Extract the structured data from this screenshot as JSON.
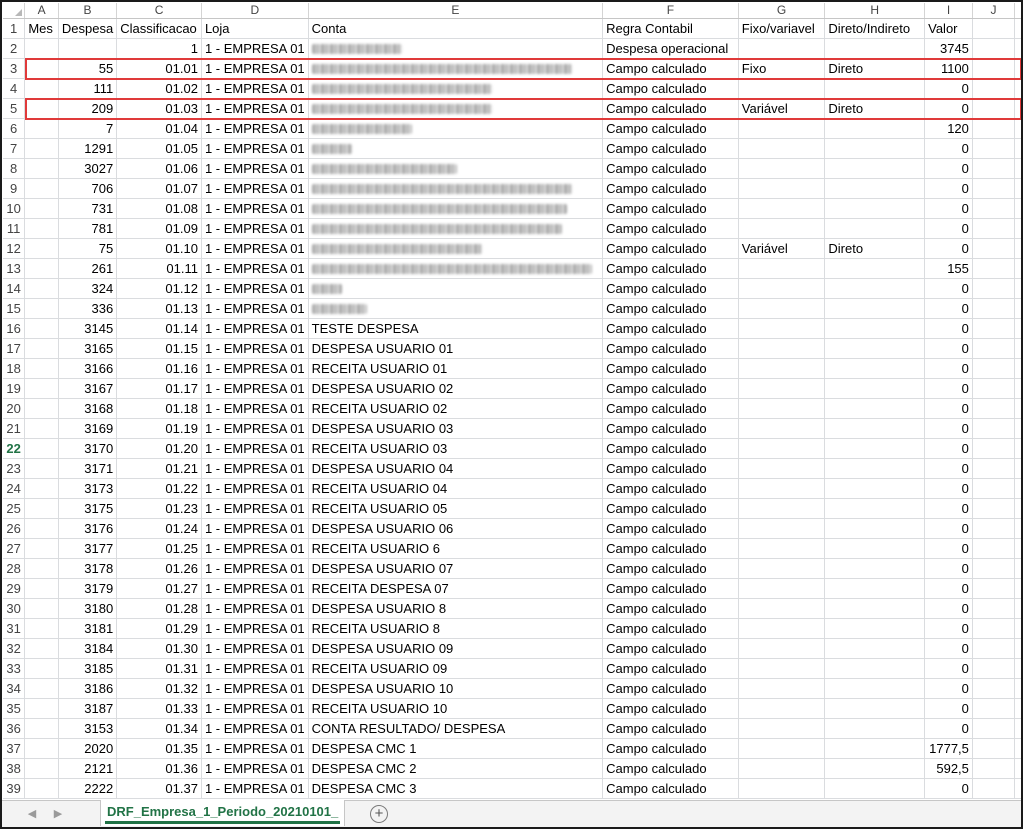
{
  "columns": [
    "A",
    "B",
    "C",
    "D",
    "E",
    "F",
    "G",
    "H",
    "I",
    "J"
  ],
  "rows": [
    {
      "n": "1",
      "cells": [
        "Mes",
        "Despesa",
        "Classificacao",
        "Loja",
        "Conta",
        "Regra Contabil",
        "Fixo/variavel",
        "Direto/Indireto",
        "Valor",
        ""
      ]
    },
    {
      "n": "2",
      "cells": [
        "",
        "",
        "1",
        "1 - EMPRESA 01",
        "",
        "Despesa operacional",
        "",
        "",
        "3745",
        ""
      ]
    },
    {
      "n": "3",
      "cells": [
        "",
        "55",
        "01.01",
        "1 - EMPRESA 01",
        "",
        "Campo calculado",
        "Fixo",
        "Direto",
        "1100",
        ""
      ]
    },
    {
      "n": "4",
      "cells": [
        "",
        "111",
        "01.02",
        "1 - EMPRESA 01",
        "",
        "Campo calculado",
        "",
        "",
        "0",
        ""
      ]
    },
    {
      "n": "5",
      "cells": [
        "",
        "209",
        "01.03",
        "1 - EMPRESA 01",
        "",
        "Campo calculado",
        "Variável",
        "Direto",
        "0",
        ""
      ]
    },
    {
      "n": "6",
      "cells": [
        "",
        "7",
        "01.04",
        "1 - EMPRESA 01",
        "",
        "Campo calculado",
        "",
        "",
        "120",
        ""
      ]
    },
    {
      "n": "7",
      "cells": [
        "",
        "1291",
        "01.05",
        "1 - EMPRESA 01",
        "",
        "Campo calculado",
        "",
        "",
        "0",
        ""
      ]
    },
    {
      "n": "8",
      "cells": [
        "",
        "3027",
        "01.06",
        "1 - EMPRESA 01",
        "",
        "Campo calculado",
        "",
        "",
        "0",
        ""
      ]
    },
    {
      "n": "9",
      "cells": [
        "",
        "706",
        "01.07",
        "1 - EMPRESA 01",
        "",
        "Campo calculado",
        "",
        "",
        "0",
        ""
      ]
    },
    {
      "n": "10",
      "cells": [
        "",
        "731",
        "01.08",
        "1 - EMPRESA 01",
        "",
        "Campo calculado",
        "",
        "",
        "0",
        ""
      ]
    },
    {
      "n": "11",
      "cells": [
        "",
        "781",
        "01.09",
        "1 - EMPRESA 01",
        "",
        "Campo calculado",
        "",
        "",
        "0",
        ""
      ]
    },
    {
      "n": "12",
      "cells": [
        "",
        "75",
        "01.10",
        "1 - EMPRESA 01",
        "",
        "Campo calculado",
        "Variável",
        "Direto",
        "0",
        ""
      ]
    },
    {
      "n": "13",
      "cells": [
        "",
        "261",
        "01.11",
        "1 - EMPRESA 01",
        "",
        "Campo calculado",
        "",
        "",
        "155",
        ""
      ]
    },
    {
      "n": "14",
      "cells": [
        "",
        "324",
        "01.12",
        "1 - EMPRESA 01",
        "",
        "Campo calculado",
        "",
        "",
        "0",
        ""
      ]
    },
    {
      "n": "15",
      "cells": [
        "",
        "336",
        "01.13",
        "1 - EMPRESA 01",
        "",
        "Campo calculado",
        "",
        "",
        "0",
        ""
      ]
    },
    {
      "n": "16",
      "cells": [
        "",
        "3145",
        "01.14",
        "1 - EMPRESA 01",
        "TESTE DESPESA",
        "Campo calculado",
        "",
        "",
        "0",
        ""
      ]
    },
    {
      "n": "17",
      "cells": [
        "",
        "3165",
        "01.15",
        "1 - EMPRESA 01",
        "DESPESA USUARIO 01",
        "Campo calculado",
        "",
        "",
        "0",
        ""
      ]
    },
    {
      "n": "18",
      "cells": [
        "",
        "3166",
        "01.16",
        "1 - EMPRESA 01",
        "RECEITA USUARIO 01",
        "Campo calculado",
        "",
        "",
        "0",
        ""
      ]
    },
    {
      "n": "19",
      "cells": [
        "",
        "3167",
        "01.17",
        "1 - EMPRESA 01",
        "DESPESA USUARIO 02",
        "Campo calculado",
        "",
        "",
        "0",
        ""
      ]
    },
    {
      "n": "20",
      "cells": [
        "",
        "3168",
        "01.18",
        "1 - EMPRESA 01",
        "RECEITA USUARIO 02",
        "Campo calculado",
        "",
        "",
        "0",
        ""
      ]
    },
    {
      "n": "21",
      "cells": [
        "",
        "3169",
        "01.19",
        "1 - EMPRESA 01",
        "DESPESA USUARIO 03",
        "Campo calculado",
        "",
        "",
        "0",
        ""
      ]
    },
    {
      "n": "22",
      "cells": [
        "",
        "3170",
        "01.20",
        "1 - EMPRESA 01",
        "RECEITA USUARIO 03",
        "Campo calculado",
        "",
        "",
        "0",
        ""
      ]
    },
    {
      "n": "23",
      "cells": [
        "",
        "3171",
        "01.21",
        "1 - EMPRESA 01",
        "DESPESA USUARIO 04",
        "Campo calculado",
        "",
        "",
        "0",
        ""
      ]
    },
    {
      "n": "24",
      "cells": [
        "",
        "3173",
        "01.22",
        "1 - EMPRESA 01",
        "RECEITA USUARIO 04",
        "Campo calculado",
        "",
        "",
        "0",
        ""
      ]
    },
    {
      "n": "25",
      "cells": [
        "",
        "3175",
        "01.23",
        "1 - EMPRESA 01",
        "RECEITA USUARIO 05",
        "Campo calculado",
        "",
        "",
        "0",
        ""
      ]
    },
    {
      "n": "26",
      "cells": [
        "",
        "3176",
        "01.24",
        "1 - EMPRESA 01",
        "DESPESA USUARIO 06",
        "Campo calculado",
        "",
        "",
        "0",
        ""
      ]
    },
    {
      "n": "27",
      "cells": [
        "",
        "3177",
        "01.25",
        "1 - EMPRESA 01",
        "RECEITA USUARIO 6",
        "Campo calculado",
        "",
        "",
        "0",
        ""
      ]
    },
    {
      "n": "28",
      "cells": [
        "",
        "3178",
        "01.26",
        "1 - EMPRESA 01",
        "DESPESA USUARIO 07",
        "Campo calculado",
        "",
        "",
        "0",
        ""
      ]
    },
    {
      "n": "29",
      "cells": [
        "",
        "3179",
        "01.27",
        "1 - EMPRESA 01",
        "RECEITA DESPESA 07",
        "Campo calculado",
        "",
        "",
        "0",
        ""
      ]
    },
    {
      "n": "30",
      "cells": [
        "",
        "3180",
        "01.28",
        "1 - EMPRESA 01",
        "DESPESA USUARIO 8",
        "Campo calculado",
        "",
        "",
        "0",
        ""
      ]
    },
    {
      "n": "31",
      "cells": [
        "",
        "3181",
        "01.29",
        "1 - EMPRESA 01",
        "RECEITA USUARIO 8",
        "Campo calculado",
        "",
        "",
        "0",
        ""
      ]
    },
    {
      "n": "32",
      "cells": [
        "",
        "3184",
        "01.30",
        "1 - EMPRESA 01",
        "DESPESA USUARIO 09",
        "Campo calculado",
        "",
        "",
        "0",
        ""
      ]
    },
    {
      "n": "33",
      "cells": [
        "",
        "3185",
        "01.31",
        "1 - EMPRESA 01",
        "RECEITA USUARIO 09",
        "Campo calculado",
        "",
        "",
        "0",
        ""
      ]
    },
    {
      "n": "34",
      "cells": [
        "",
        "3186",
        "01.32",
        "1 - EMPRESA 01",
        "DESPESA USUARIO 10",
        "Campo calculado",
        "",
        "",
        "0",
        ""
      ]
    },
    {
      "n": "35",
      "cells": [
        "",
        "3187",
        "01.33",
        "1 - EMPRESA 01",
        "RECEITA USUARIO 10",
        "Campo calculado",
        "",
        "",
        "0",
        ""
      ]
    },
    {
      "n": "36",
      "cells": [
        "",
        "3153",
        "01.34",
        "1 - EMPRESA 01",
        "CONTA RESULTADO/ DESPESA",
        "Campo calculado",
        "",
        "",
        "0",
        ""
      ]
    },
    {
      "n": "37",
      "cells": [
        "",
        "2020",
        "01.35",
        "1 - EMPRESA 01",
        "DESPESA CMC 1",
        "Campo calculado",
        "",
        "",
        "1777,5",
        ""
      ]
    },
    {
      "n": "38",
      "cells": [
        "",
        "2121",
        "01.36",
        "1 - EMPRESA 01",
        "DESPESA CMC 2",
        "Campo calculado",
        "",
        "",
        "592,5",
        ""
      ]
    },
    {
      "n": "39",
      "cells": [
        "",
        "2222",
        "01.37",
        "1 - EMPRESA 01",
        "DESPESA CMC 3",
        "Campo calculado",
        "",
        "",
        "0",
        ""
      ]
    }
  ],
  "blurred_conta_rows": [
    "2",
    "3",
    "4",
    "5",
    "6",
    "7",
    "8",
    "9",
    "10",
    "11",
    "12",
    "13",
    "14",
    "15"
  ],
  "active_row": "22",
  "highlighted_rows": [
    "3",
    "5"
  ],
  "sheet_tab": {
    "label": "DRF_Empresa_1_Periodo_20210101_"
  },
  "colors": {
    "accent": "#217346",
    "highlight": "#e03a3a",
    "gridline": "#dadcdf"
  }
}
